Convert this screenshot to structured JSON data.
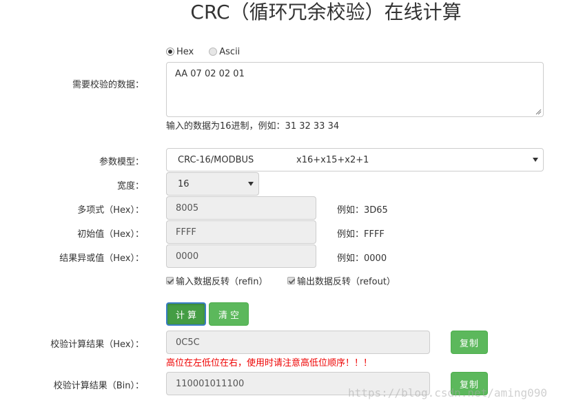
{
  "page": {
    "title": "CRC（循环冗余校验）在线计算"
  },
  "input_mode": {
    "options": [
      {
        "label": "Hex",
        "checked": true
      },
      {
        "label": "Ascii",
        "checked": false
      }
    ]
  },
  "data_field": {
    "label": "需要校验的数据：",
    "value": "AA 07 02 02 01",
    "hint": "输入的数据为16进制，例如：31 32 33 34"
  },
  "model": {
    "label": "参数模型：",
    "selected_name": "CRC-16/MODBUS",
    "selected_poly": "x16+x15+x2+1"
  },
  "width": {
    "label": "宽度：",
    "value": "16"
  },
  "poly": {
    "label": "多项式（Hex）：",
    "value": "8005",
    "example": "例如：3D65"
  },
  "init": {
    "label": "初始值（Hex）：",
    "value": "FFFF",
    "example": "例如：FFFF"
  },
  "xorout": {
    "label": "结果异或值（Hex）：",
    "value": "0000",
    "example": "例如：0000"
  },
  "reflect": {
    "refin_label": "输入数据反转（refin）",
    "refin_checked": true,
    "refout_label": "输出数据反转（refout）",
    "refout_checked": true
  },
  "actions": {
    "calc_label": "计算",
    "clear_label": "清空"
  },
  "result_hex": {
    "label": "校验计算结果（Hex）：",
    "value": "0C5C",
    "copy_label": "复制",
    "warning": "高位在左低位在右，使用时请注意高低位顺序！！！"
  },
  "result_bin": {
    "label": "校验计算结果（Bin）：",
    "value": "110001011100",
    "copy_label": "复制"
  },
  "watermark": "https://blog.csdn.net/aming090",
  "colors": {
    "button_green": "#5cb85c",
    "button_active": "#449d44",
    "warning_red": "#e00000"
  }
}
